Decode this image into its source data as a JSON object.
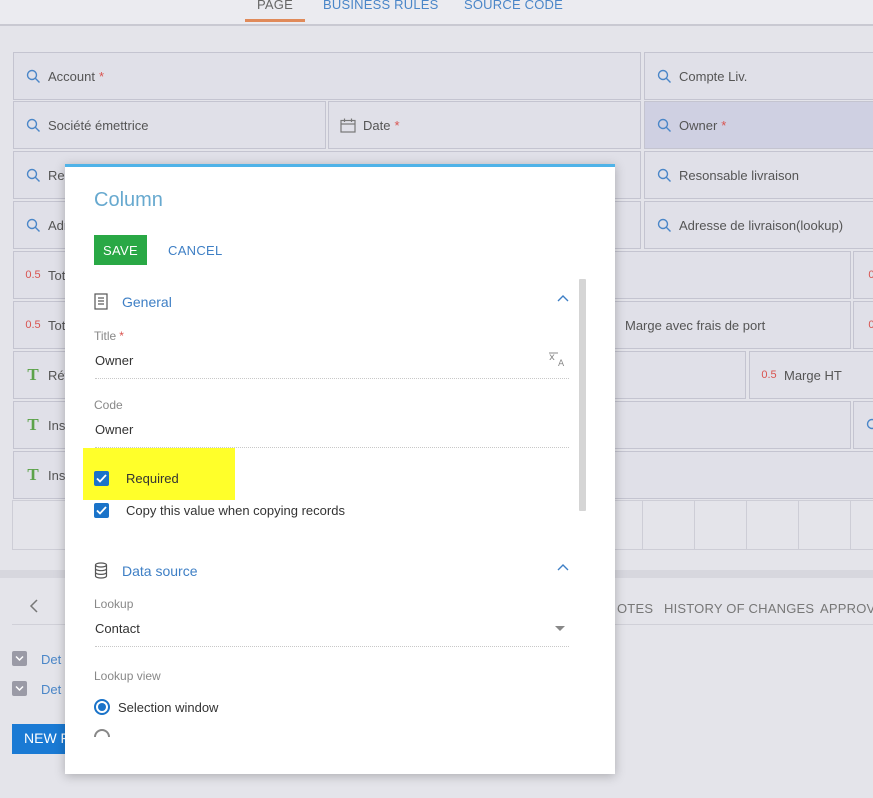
{
  "top_tabs": [
    {
      "label": "PAGE",
      "active": true
    },
    {
      "label": "BUSINESS RULES",
      "active": false
    },
    {
      "label": "SOURCE CODE",
      "active": false
    }
  ],
  "grid": {
    "account": "Account",
    "compte_liv": "Compte Liv.",
    "societe": "Société émettrice",
    "date": "Date",
    "owner": "Owner",
    "res_partial": "Res",
    "responsable_livraison": "Resonsable livraison",
    "adr_partial": "Adr",
    "adresse_livraison": "Adresse de livraison(lookup)",
    "tot1_partial": "Tot",
    "tot2_partial": "Tot",
    "marge_frais": "Marge avec frais de port",
    "ref_partial": "Réf",
    "marge_ht": "Marge HT",
    "inst1_partial": "Inst",
    "inst2_partial": "Inst",
    "num_icon_text": "0.5",
    "num_icon_text_right": "0.",
    "required_mark": "*",
    "text_icon": "T"
  },
  "lower": {
    "tabs": [
      "OTES",
      "HISTORY OF CHANGES",
      "APPROVA"
    ],
    "details": [
      "Det",
      "Det"
    ],
    "new_button": "NEW F"
  },
  "modal": {
    "title": "Column",
    "save_label": "SAVE",
    "cancel_label": "CANCEL",
    "general": {
      "section_title": "General",
      "title_label": "Title",
      "title_required": "*",
      "title_value": "Owner",
      "code_label": "Code",
      "code_value": "Owner",
      "required_label": "Required",
      "required_checked": true,
      "copy_label": "Copy this value when copying records",
      "copy_checked": true
    },
    "data_source": {
      "section_title": "Data source",
      "lookup_label": "Lookup",
      "lookup_value": "Contact",
      "lookup_view_label": "Lookup view",
      "selection_window_label": "Selection window",
      "selection_window_selected": true
    }
  },
  "colors": {
    "accent_blue": "#3e7fc5",
    "title_blue": "#67a9cf",
    "save_green": "#29a845",
    "highlight_yellow": "#ffff2a",
    "required_red": "#d9534f",
    "tab_underline": "#e08a5a"
  },
  "icons": {
    "lookup": "magnifier-icon",
    "date": "calendar-icon",
    "number": "decimal-icon",
    "text": "text-icon",
    "general_section": "document-icon",
    "data_source_section": "database-icon",
    "translate": "translate-icon",
    "collapse": "chevron-up-icon",
    "back": "chevron-left-icon"
  }
}
